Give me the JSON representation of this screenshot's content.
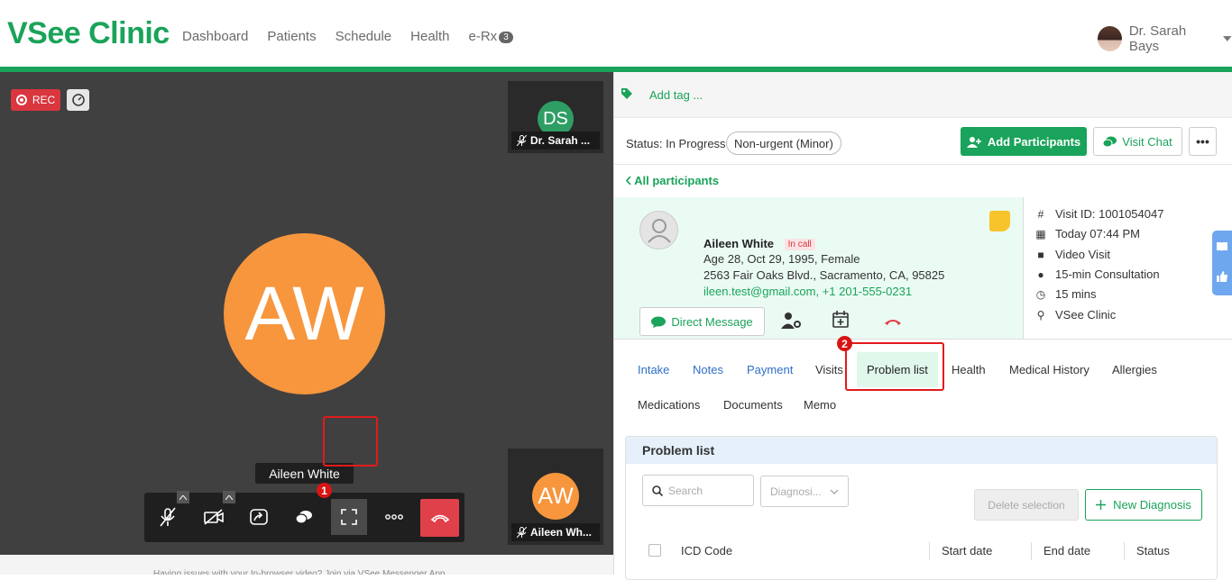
{
  "header": {
    "logo": "VSee Clinic",
    "nav": [
      "Dashboard",
      "Patients",
      "Schedule",
      "Health",
      "e-Rx"
    ],
    "erx_badge": "3",
    "user_name": "Dr. Sarah Bays"
  },
  "video": {
    "rec_label": "REC",
    "main_initials": "AW",
    "thumb_top_initials": "DS",
    "thumb_top_name": "Dr. Sarah ...",
    "thumb_bottom_initials": "AW",
    "thumb_bottom_name": "Aileen Wh...",
    "tooltip": "Aileen White",
    "step1": "1",
    "footer_text": "Having issues with your In-browser video? Join via VSee Messenger App"
  },
  "panel": {
    "add_tag": "Add tag ...",
    "status_label": "Status: In Progress",
    "urgency": "Non-urgent (Minor)",
    "add_participants": "Add Participants",
    "visit_chat": "Visit Chat",
    "more": "•••",
    "all_participants": "All participants"
  },
  "patient": {
    "name": "Aileen White",
    "call_badge": "In call",
    "demographics": "Age 28, Oct 29, 1995, Female",
    "address": "2563 Fair Oaks Blvd., Sacramento, CA, 95825",
    "contact": "ileen.test@gmail.com, +1 201-555-0231",
    "direct_message": "Direct Message"
  },
  "visit": {
    "id": "Visit ID: 1001054047",
    "time": "Today 07:44 PM",
    "type": "Video Visit",
    "consult": "15-min Consultation",
    "duration": "15 mins",
    "location": "VSee Clinic"
  },
  "tabs": {
    "intake": "Intake",
    "notes": "Notes",
    "payment": "Payment",
    "visits": "Visits",
    "problem_list": "Problem list",
    "health": "Health",
    "medical_history": "Medical History",
    "allergies": "Allergies",
    "medications": "Medications",
    "documents": "Documents",
    "memo": "Memo",
    "step2": "2"
  },
  "problem_list": {
    "title": "Problem list",
    "search_placeholder": "Search",
    "diagnosis_placeholder": "Diagnosi...",
    "delete_selection": "Delete selection",
    "new_diagnosis": "New Diagnosis",
    "columns": [
      "ICD Code",
      "Start date",
      "End date",
      "Status"
    ]
  },
  "colors": {
    "brand_green": "#1aa35a",
    "alert_red": "#e01b1b",
    "avatar_orange": "#f7963d"
  }
}
